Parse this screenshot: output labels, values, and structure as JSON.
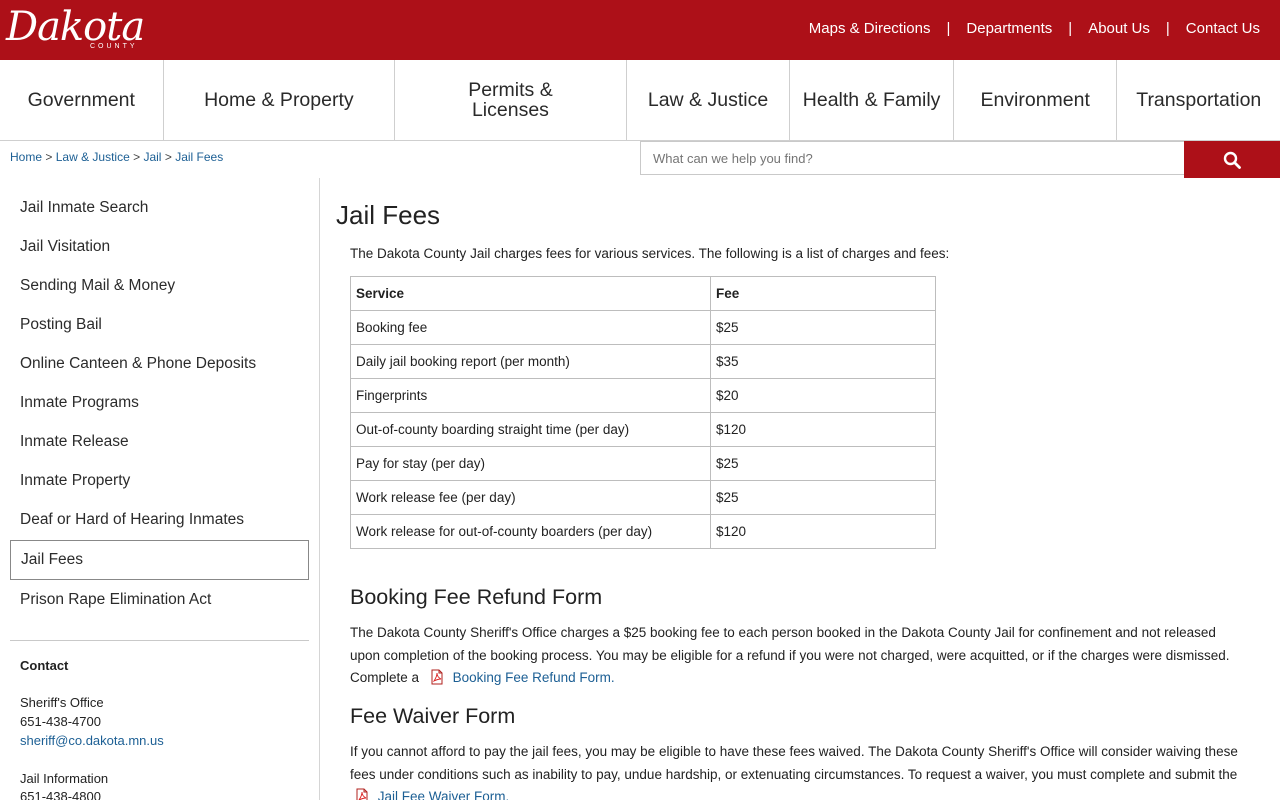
{
  "logo": {
    "script": "Dakota",
    "sub": "COUNTY"
  },
  "utility_nav": [
    {
      "label": "Maps & Directions"
    },
    {
      "label": "Departments"
    },
    {
      "label": "About Us"
    },
    {
      "label": "Contact Us"
    }
  ],
  "utility_separator": "|",
  "main_nav": [
    {
      "label": "Government"
    },
    {
      "label": "Home & Property"
    },
    {
      "label": "Permits & Licenses"
    },
    {
      "label": "Law & Justice"
    },
    {
      "label": "Health & Family"
    },
    {
      "label": "Environment"
    },
    {
      "label": "Transportation"
    }
  ],
  "breadcrumb": {
    "items": [
      "Home",
      "Law & Justice",
      "Jail",
      "Jail Fees"
    ],
    "separator": ">"
  },
  "search": {
    "placeholder": "What can we help you find?"
  },
  "sidebar": {
    "items": [
      {
        "label": "Jail Inmate Search"
      },
      {
        "label": "Jail Visitation"
      },
      {
        "label": "Sending Mail & Money"
      },
      {
        "label": "Posting Bail"
      },
      {
        "label": "Online Canteen & Phone Deposits"
      },
      {
        "label": "Inmate Programs"
      },
      {
        "label": "Inmate Release"
      },
      {
        "label": "Inmate Property"
      },
      {
        "label": "Deaf or Hard of Hearing Inmates"
      },
      {
        "label": "Jail Fees"
      },
      {
        "label": "Prison Rape Elimination Act"
      }
    ],
    "contact": {
      "heading": "Contact",
      "office_name": "Sheriff's Office",
      "office_phone": "651-438-4700",
      "office_email": "sheriff@co.dakota.mn.us",
      "jail_name": "Jail Information",
      "jail_phone": "651-438-4800"
    }
  },
  "content": {
    "title": "Jail Fees",
    "intro": "The Dakota County Jail charges fees for various services. The following is a list of charges and fees:",
    "table": {
      "headers": [
        "Service",
        "Fee"
      ],
      "rows": [
        [
          "Booking fee",
          "$25"
        ],
        [
          "Daily jail booking report (per month)",
          "$35"
        ],
        [
          "Fingerprints",
          "$20"
        ],
        [
          "Out-of-county boarding straight time (per day)",
          "$120"
        ],
        [
          "Pay for stay (per day)",
          "$25"
        ],
        [
          "Work release fee (per day)",
          "$25"
        ],
        [
          "Work release for out-of-county boarders (per day)",
          "$120"
        ]
      ]
    },
    "refund": {
      "heading": "Booking Fee Refund Form",
      "line1": "The Dakota County Sheriff's Office charges a $25 booking fee to each person booked in the Dakota County Jail for confinement and not released",
      "line2": "upon completion of the booking process. You may be eligible for a refund if you were not charged, were acquitted, or if the charges were dismissed.",
      "line3_prefix": "Complete a",
      "link": "Booking Fee Refund Form."
    },
    "waiver": {
      "heading": "Fee Waiver Form",
      "line1": "If you cannot afford to pay the jail fees, you may be eligible to have these fees waived. The Dakota County Sheriff's Office will consider waiving these",
      "line2": "fees under conditions such as inability to pay, undue hardship, or extenuating circumstances. To request a waiver, you must complete and submit the",
      "link": "Jail Fee Waiver Form."
    }
  },
  "colors": {
    "brand_red": "#ad1018",
    "link_blue": "#1c5f94"
  }
}
